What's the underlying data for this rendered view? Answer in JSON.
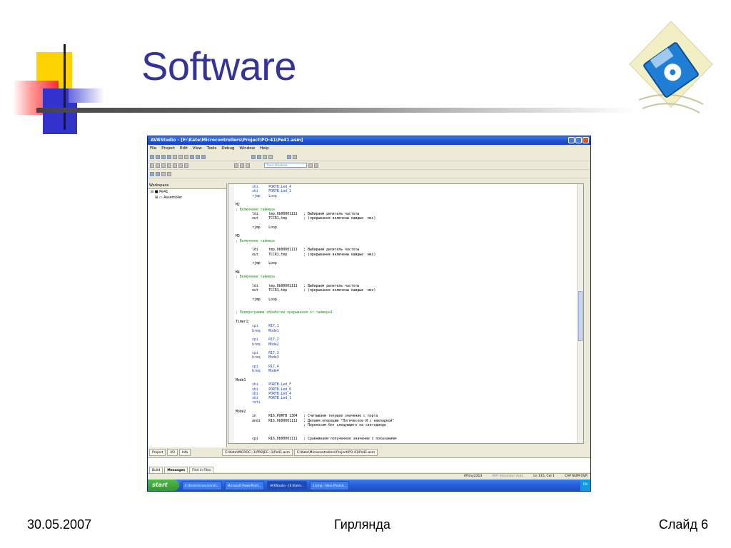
{
  "slide": {
    "title": "Software",
    "footer_date": "30.05.2007",
    "footer_center": "Гирлянда",
    "footer_right": "Слайд 6",
    "colors": {
      "title": "#333399",
      "accent_yellow": "#fcd300",
      "accent_red": "#ff2a2a",
      "accent_blue": "#3333cc"
    }
  },
  "app": {
    "window_title": "AVRStudio - [E:\\Kate\\Microcontrollers\\Project\\PO-41\\Pe41.asm]",
    "menu": [
      "File",
      "Project",
      "Edit",
      "View",
      "Tools",
      "Debug",
      "Window",
      "Help"
    ],
    "toolbar_combo": "Trace Disabled",
    "workspace": {
      "header": "Workspace",
      "items": [
        "Pe41",
        "Assembler"
      ]
    },
    "code_lines": [
      {
        "text": "        sbi     PORTB.Led_4",
        "kind": "kw"
      },
      {
        "text": "        sbi     PORTB.Led_1",
        "kind": "kw"
      },
      {
        "text": "        rjmp    Loop",
        "kind": "kw"
      },
      {
        "text": "",
        "kind": "plain"
      },
      {
        "text": "M2",
        "kind": "plain"
      },
      {
        "text": "; Включение таймера",
        "kind": "comment"
      },
      {
        "text": "        ldi     tmp,0b00001111   ; Выбираем делитель частоты",
        "kind": "plain"
      },
      {
        "text": "        out     TCCR1,tmp        ; (прерывания включены каждые  мкс)",
        "kind": "plain"
      },
      {
        "text": "",
        "kind": "plain"
      },
      {
        "text": "        rjmp    Loop",
        "kind": "plain"
      },
      {
        "text": "",
        "kind": "plain"
      },
      {
        "text": "M3",
        "kind": "plain"
      },
      {
        "text": "; Включение таймера",
        "kind": "comment"
      },
      {
        "text": "",
        "kind": "plain"
      },
      {
        "text": "        ldi     tmp,0b00001111   ; Выбираем делитель частоты",
        "kind": "plain"
      },
      {
        "text": "        out     TCCR1,tmp        ; (прерывания включены каждые  мкс)",
        "kind": "plain"
      },
      {
        "text": "",
        "kind": "plain"
      },
      {
        "text": "        rjmp    Loop",
        "kind": "plain"
      },
      {
        "text": "",
        "kind": "plain"
      },
      {
        "text": "M4",
        "kind": "plain"
      },
      {
        "text": "; Включение таймера",
        "kind": "comment"
      },
      {
        "text": "",
        "kind": "plain"
      },
      {
        "text": "        ldi     tmp,0b00001111   ; Выбираем делитель частоты",
        "kind": "plain"
      },
      {
        "text": "        out     TCCR1,tmp        ; (прерывания включены каждые  мкс)",
        "kind": "plain"
      },
      {
        "text": "",
        "kind": "plain"
      },
      {
        "text": "        rjmp    Loop",
        "kind": "plain"
      },
      {
        "text": "",
        "kind": "plain"
      },
      {
        "text": "",
        "kind": "plain"
      },
      {
        "text": "; Подпрограмма обработки прерывания от таймера1",
        "kind": "comment"
      },
      {
        "text": "",
        "kind": "plain"
      },
      {
        "text": "Timer1:",
        "kind": "plain"
      },
      {
        "text": "        cpi     R17,1",
        "kind": "kw"
      },
      {
        "text": "        breq    Mode1",
        "kind": "kw"
      },
      {
        "text": "",
        "kind": "plain"
      },
      {
        "text": "        cpi     R17,2",
        "kind": "kw"
      },
      {
        "text": "        breq    Mode2",
        "kind": "kw"
      },
      {
        "text": "",
        "kind": "plain"
      },
      {
        "text": "        cpi     R17,3",
        "kind": "kw"
      },
      {
        "text": "        breq    Mode3",
        "kind": "kw"
      },
      {
        "text": "",
        "kind": "plain"
      },
      {
        "text": "        cpi     R17,4",
        "kind": "kw"
      },
      {
        "text": "        breq    Mode4",
        "kind": "kw"
      },
      {
        "text": "",
        "kind": "plain"
      },
      {
        "text": "Mode1",
        "kind": "plain"
      },
      {
        "text": "        sbi     PORTB.Led_F",
        "kind": "kw"
      },
      {
        "text": "        sbi     PORTB.Led_0",
        "kind": "kw"
      },
      {
        "text": "        sbi     PORTB.Led_4",
        "kind": "kw"
      },
      {
        "text": "        sbi     PORTB.Led_1",
        "kind": "kw"
      },
      {
        "text": "        reti",
        "kind": "kw"
      },
      {
        "text": "",
        "kind": "plain"
      },
      {
        "text": "Mode2",
        "kind": "plain"
      },
      {
        "text": "        in      R16,PORTB 1304   ; Считываем текущее значение с порта",
        "kind": "plain"
      },
      {
        "text": "        andi    R16,0b00001111   ; Делаем операцию \"Логическое И с накладкой\"",
        "kind": "plain"
      },
      {
        "text": "                                 ; Переносим бит следующего на светодиоде",
        "kind": "plain"
      },
      {
        "text": "",
        "kind": "plain"
      },
      {
        "text": "",
        "kind": "plain"
      },
      {
        "text": "        cpi     R16,0b00001111   ; Сравниваем полученное значение с показанием",
        "kind": "plain"
      }
    ],
    "doc_tabs": [
      "Project",
      "I/O",
      "Info"
    ],
    "file_tabs": [
      "E:\\Kate\\MICROC~1\\PROJEC~1\\Pe41.asm",
      "E:\\Kate\\Microcontrollers\\Project\\PO-41\\Pe41.asm"
    ],
    "output_tabs": [
      "Build",
      "Messages",
      "Find in Files"
    ],
    "status": [
      "ATtiny2313",
      "AVR Simulator  Auto",
      "Ln 115, Col 1",
      "CAP  NUM  OVR"
    ],
    "taskbar": {
      "start": "start",
      "items": [
        "E:\\Kate\\microcontroll...",
        "Microsoft PowerPoint...",
        "AVRStudio - [E:\\Kate\\...",
        "1.bmp - Nero PhotoS..."
      ],
      "tray": "EN"
    }
  }
}
